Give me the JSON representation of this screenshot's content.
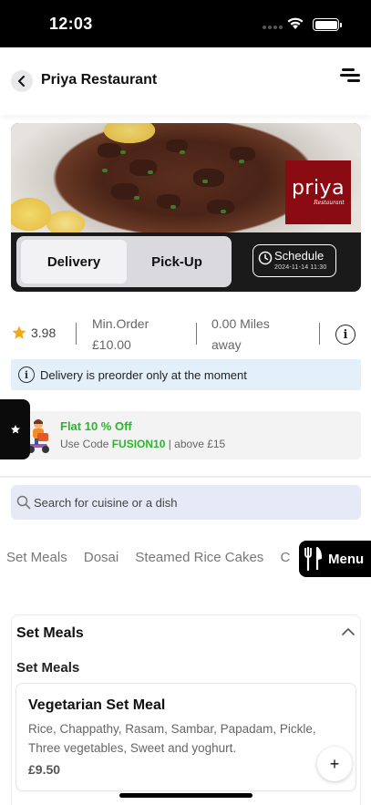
{
  "status_bar": {
    "time": "12:03"
  },
  "header": {
    "title": "Priya Restaurant",
    "back_icon": "chevron-left-icon",
    "menu_icon": "menu-lines-icon"
  },
  "banner": {
    "logo_main": "priya",
    "logo_sub": "Restaurant",
    "delivery_label": "Delivery",
    "pickup_label": "Pick-Up",
    "schedule_label": "Schedule",
    "schedule_time": "2024-11-14 11:30"
  },
  "info": {
    "rating": "3.98",
    "min_order_label": "Min.Order",
    "min_order_value": "£10.00",
    "distance_value": "0.00 Miles",
    "distance_label": "away",
    "info_glyph": "i"
  },
  "notice": {
    "text": "Delivery is preorder only at the moment"
  },
  "offer": {
    "title": "Flat 10 % Off",
    "code_prefix": "Use Code ",
    "code": "FUSION10",
    "code_suffix": " | above £15"
  },
  "search": {
    "placeholder": "Search for cuisine or a dish"
  },
  "categories": [
    "Set Meals",
    "Dosai",
    "Steamed Rice Cakes",
    "C"
  ],
  "menu_button": {
    "label": "Menu"
  },
  "section": {
    "title": "Set Meals",
    "subtitle": "Set Meals",
    "item": {
      "name": "Vegetarian Set Meal",
      "description": "Rice, Chappathy, Rasam, Sambar, Papadam, Pickle, Three vegetables, Sweet and yoghurt.",
      "price": "£9.50",
      "add_label": "+"
    }
  },
  "colors": {
    "offer_green": "#2cb52c",
    "notice_bg": "#e3f0fa",
    "logo_red": "#8b0b12",
    "star": "#f1a915"
  }
}
